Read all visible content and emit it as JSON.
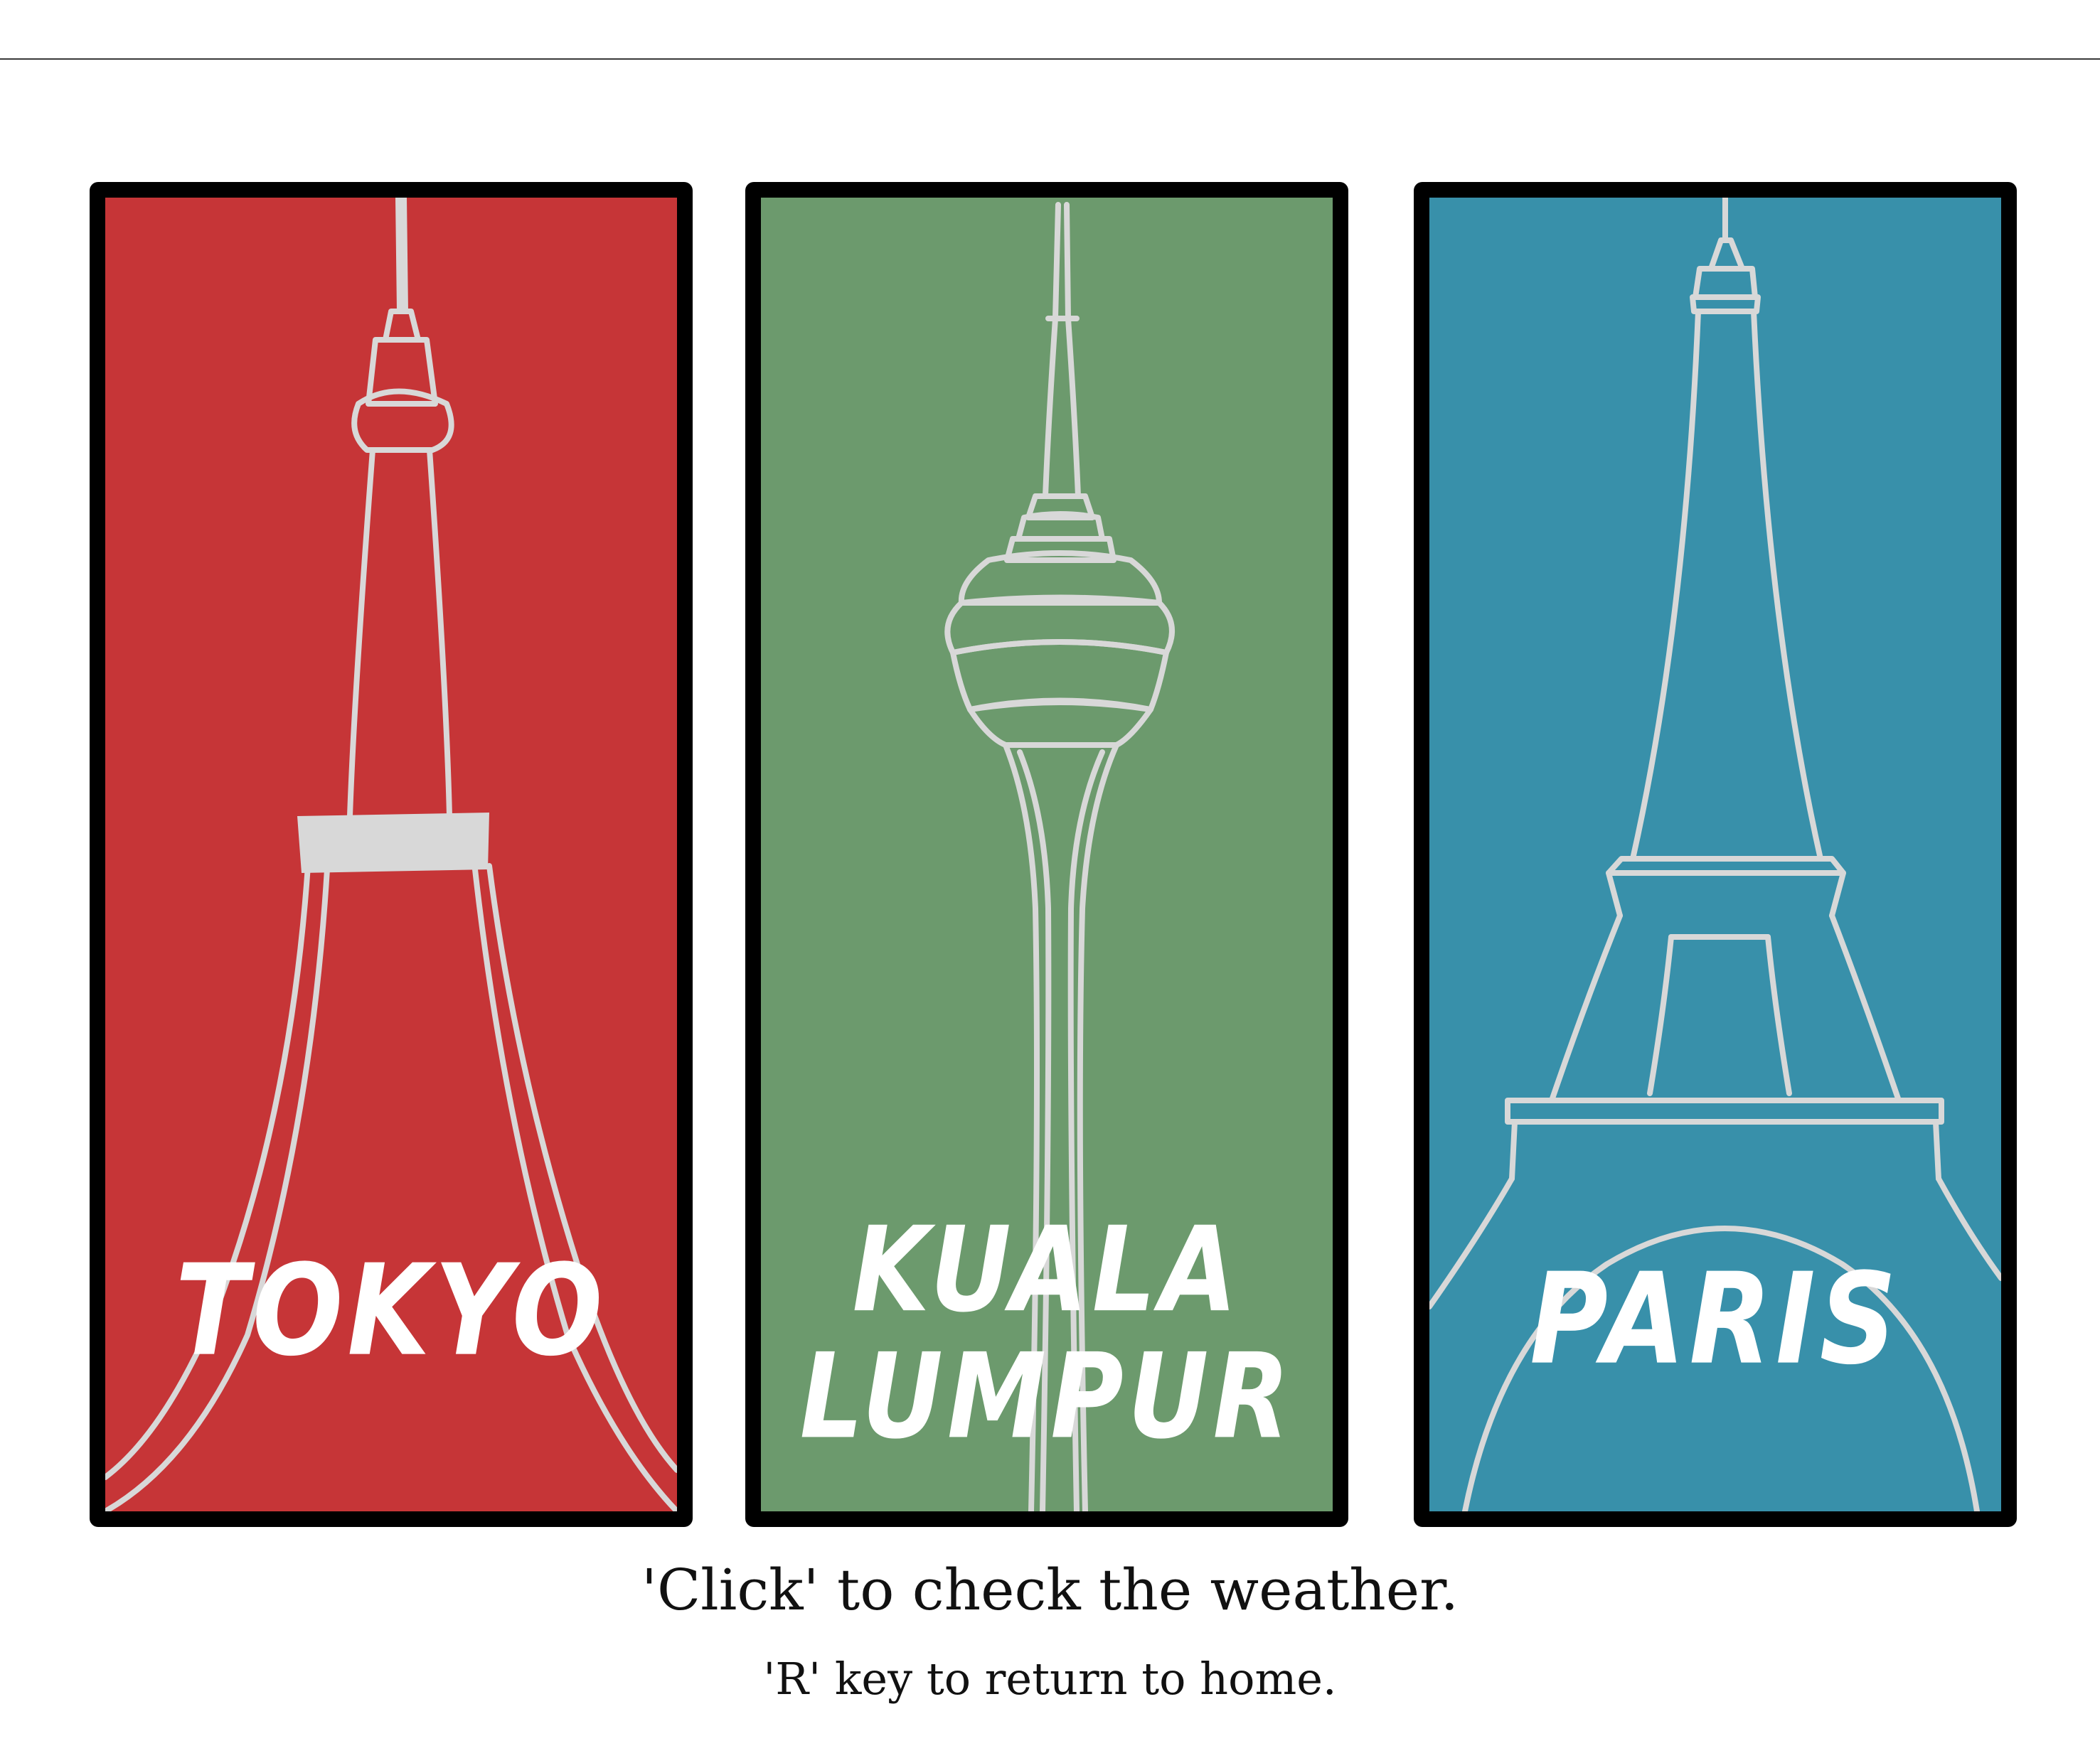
{
  "panels": [
    {
      "id": "tokyo",
      "label": "TOKYO",
      "background": "#c63537",
      "icon": "tokyo-tower-icon"
    },
    {
      "id": "kuala-lumpur",
      "label_line1": "KUALA",
      "label_line2": "LUMPUR",
      "background": "#6c9a6d",
      "icon": "kl-tower-icon"
    },
    {
      "id": "paris",
      "label": "PARIS",
      "background": "#3890aa",
      "icon": "eiffel-tower-icon"
    }
  ],
  "outline_color": "#d8d8d8",
  "frame_color": "#000000",
  "instructions": {
    "main": "'Click' to check the weather.",
    "sub": "'R' key to return to home."
  }
}
